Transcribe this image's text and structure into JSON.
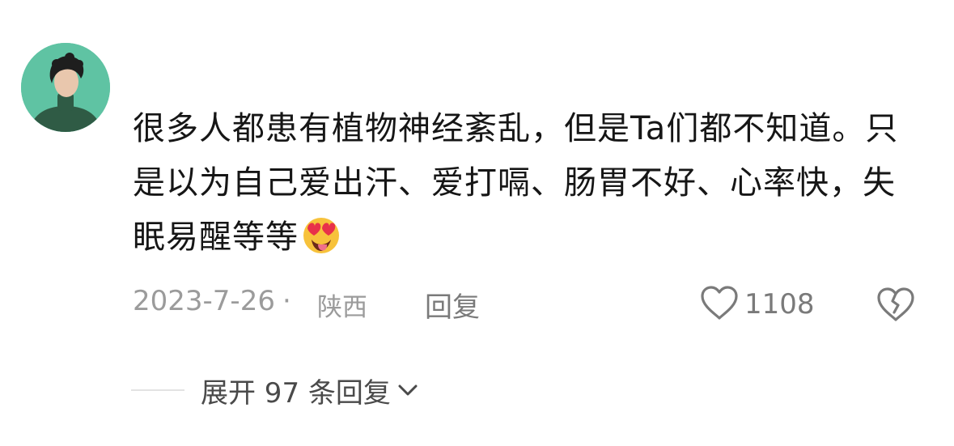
{
  "comment": {
    "text": "很多人都患有植物神经紊乱，但是Ta们都不知道。只是以为自己爱出汗、爱打嗝、肠胃不好、心率快，失眠易醒等等",
    "emoji_icon": "heart-eyes-tongue-emoji",
    "date": "2023-7-26",
    "separator": "·",
    "location": "陕西",
    "reply_label": "回复",
    "like_count": "1108",
    "expand_label": "展开 97 条回复"
  },
  "colors": {
    "avatar_bg": "#5fc3a3",
    "meta_text": "#9b9b9b",
    "action_text": "#7a7a7a"
  }
}
